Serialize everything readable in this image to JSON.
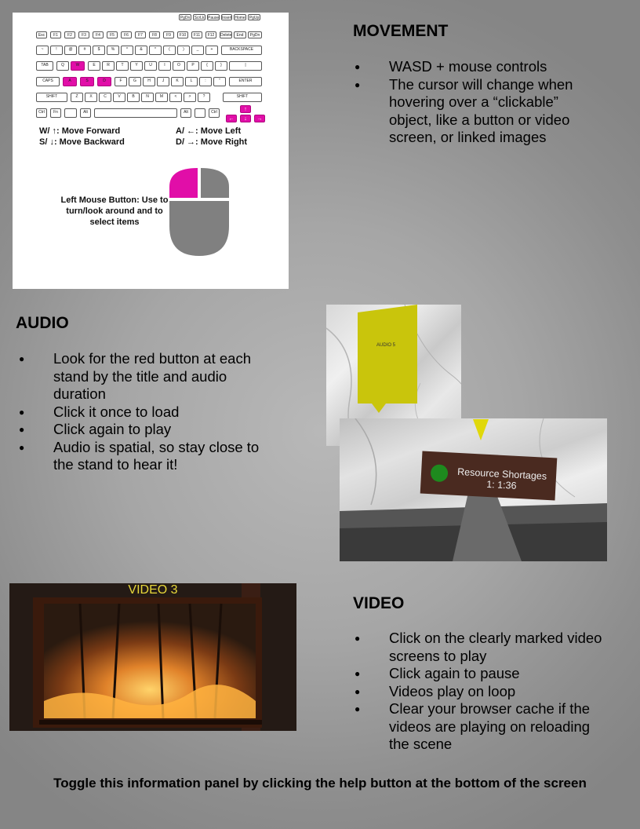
{
  "movement": {
    "title": "MOVEMENT",
    "bullets": [
      "WASD + mouse controls",
      "The cursor will change when hovering over a “clickable” object, like a button or video screen, or linked images"
    ]
  },
  "keyboard_graphic": {
    "forward_label": "W/ ↑: Move Forward",
    "backward_label": "S/ ↓: Move Backward",
    "left_label": "A/ ←: Move Left",
    "right_label": "D/ →: Move Right",
    "mouse_label": "Left Mouse Button: Use to turn/look around and to select items",
    "highlight_color": "#e10ea8"
  },
  "audio": {
    "title": "AUDIO",
    "bullets": [
      "Look for the red button at each stand by the title and audio duration",
      "Click it once to load",
      "Click again to play",
      "Audio is spatial, so stay close to the stand to hear it!"
    ],
    "banner_label": "AUDIO 5",
    "sign_title": "Resource Shortages",
    "sign_duration": "1: 1:36"
  },
  "video": {
    "title": "VIDEO",
    "bullets": [
      "Click on the clearly marked video screens to play",
      "Click again to pause",
      "Videos play on loop",
      "Clear your browser cache if the videos are playing on reloading the scene"
    ],
    "screen_label": "VIDEO 3"
  },
  "footer": "Toggle this information panel by clicking the help button at the bottom of the screen"
}
